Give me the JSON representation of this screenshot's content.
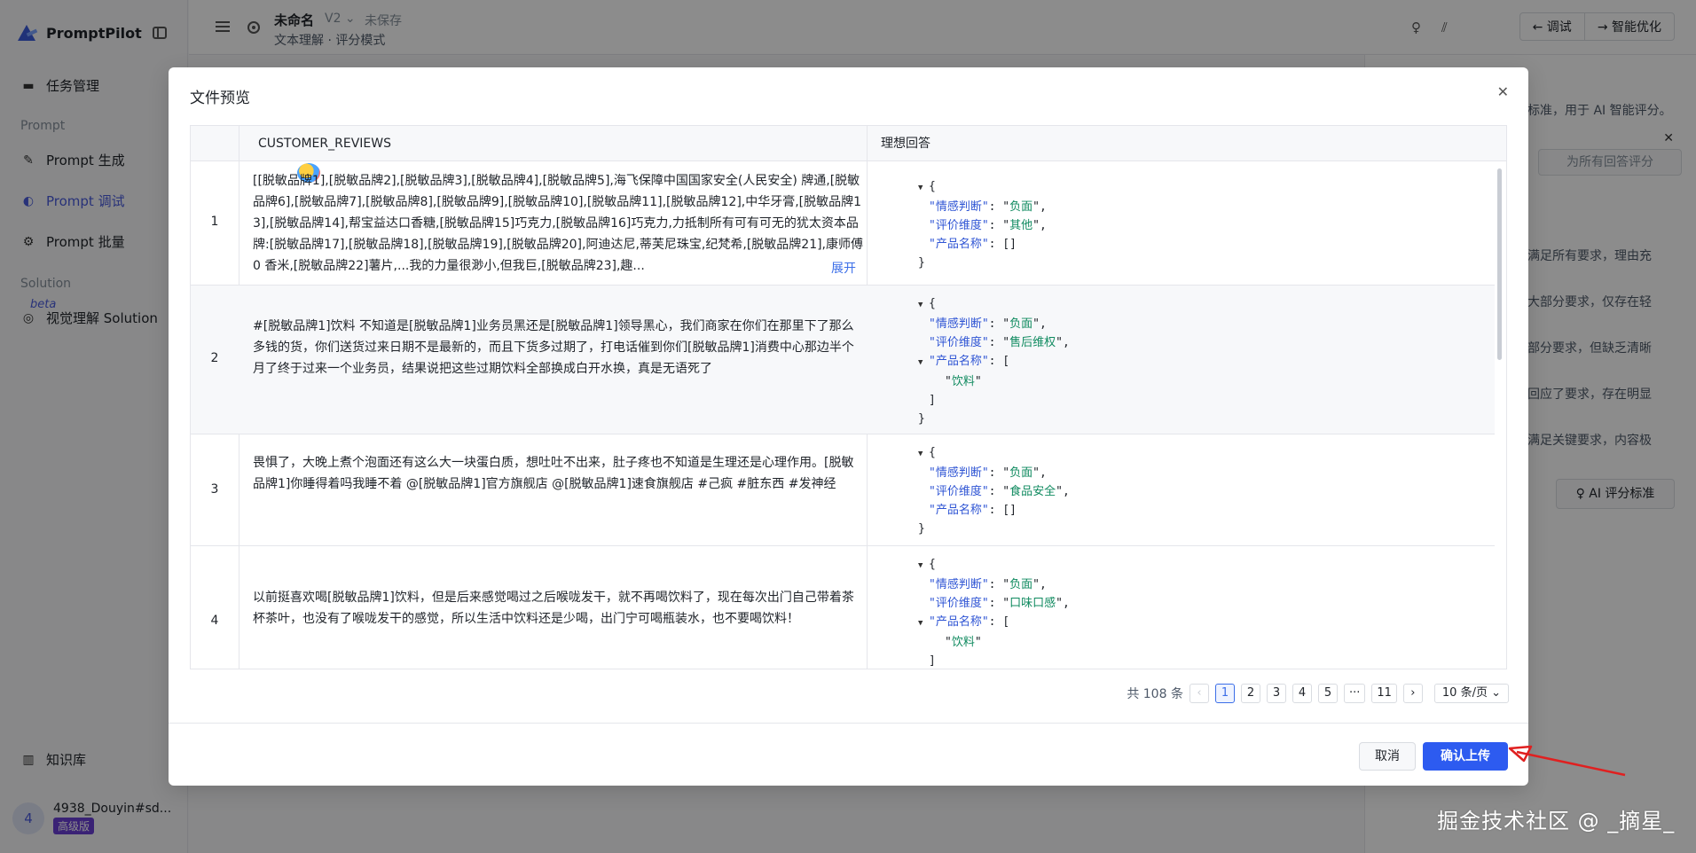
{
  "app": {
    "brand": "PromptPilot",
    "nav": {
      "task_mgmt": "任务管理",
      "group_prompt": "Prompt",
      "prompt_gen": "Prompt 生成",
      "prompt_debug": "Prompt 调试",
      "prompt_batch": "Prompt 批量",
      "group_solution": "Solution",
      "beta": "beta",
      "vision_solution": "视觉理解 Solution",
      "knowledge": "知识库"
    },
    "user": {
      "initial": "4",
      "name": "4938_Douyin#sd...",
      "tier": "高级版"
    },
    "topbar": {
      "title": "未命名",
      "version": "V2 ⌄",
      "save_status": "未保存",
      "subtitle": "文本理解 · 评分模式",
      "debug_label": "← 调试",
      "optimize_label": "→ 智能优化"
    },
    "right_panel": {
      "line1": "标准，用于 AI 智能评分。",
      "score_all_btn": "为所有回答评分",
      "criteria": [
        "满足所有要求，理由充",
        "大部分要求，仅存在轻",
        "部分要求，但缺乏清晰",
        "回应了要求，存在明显",
        "满足关键要求，内容极"
      ],
      "ai_criteria_btn": "♀ AI 评分标准"
    }
  },
  "modal": {
    "title": "文件预览",
    "columns": {
      "col1": "CUSTOMER_REVIEWS",
      "col2": "理想回答"
    },
    "rows": [
      {
        "num": "1",
        "text": "[[脱敏品牌1],[脱敏品牌2],[脱敏品牌3],[脱敏品牌4],[脱敏品牌5],海飞保障中国国家安全(人民安全) 牌通,[脱敏品牌6],[脱敏品牌7],[脱敏品牌8],[脱敏品牌9],[脱敏品牌10],[脱敏品牌11],[脱敏品牌12],中华牙膏,[脱敏品牌13],[脱敏品牌14],帮宝益达口香糖,[脱敏品牌15]巧克力,[脱敏品牌16]巧克力,力抵制所有可有可无的犹太资本品牌:[脱敏品牌17],[脱敏品牌18],[脱敏品牌19],[脱敏品牌20],阿迪达尼,蒂芙尼珠宝,纪梵希,[脱敏品牌21],康师傅 0 香米,[脱敏品牌22]薯片,...我的力量很渺小,但我巨,[脱敏品牌23],趣...",
        "expand": "展开",
        "answer": {
          "sentiment": "负面",
          "dimension": "其他",
          "products": []
        }
      },
      {
        "num": "2",
        "text": "#[脱敏品牌1]饮料 不知道是[脱敏品牌1]业务员黑还是[脱敏品牌1]领导黑心，我们商家在你们在那里下了那么多钱的货，你们送货过来日期不是最新的，而且下货多过期了，打电话催到你们[脱敏品牌1]消费中心那边半个月了终于过来一个业务员，结果说把这些过期饮料全部换成白开水换，真是无语死了",
        "answer": {
          "sentiment": "负面",
          "dimension": "售后维权",
          "products": [
            "饮料"
          ]
        }
      },
      {
        "num": "3",
        "text": "畏惧了，大晚上煮个泡面还有这么大一块蛋白质，想吐吐不出来，肚子疼也不知道是生理还是心理作用。[脱敏品牌1]你睡得着吗我睡不着 @[脱敏品牌1]官方旗舰店 @[脱敏品牌1]速食旗舰店 #己疯 #脏东西 #发神经",
        "answer": {
          "sentiment": "负面",
          "dimension": "食品安全",
          "products": []
        }
      },
      {
        "num": "4",
        "text": "以前挺喜欢喝[脱敏品牌1]饮料，但是后来感觉喝过之后喉咙发干，就不再喝饮料了，现在每次出门自己带着茶杯茶叶，也没有了喉咙发干的感觉，所以生活中饮料还是少喝，出门宁可喝瓶装水，也不要喝饮料！",
        "answer": {
          "sentiment": "负面",
          "dimension": "口味口感",
          "products": [
            "饮料"
          ]
        }
      }
    ],
    "json_keys": {
      "sentiment": "\"情感判断\"",
      "dimension": "\"评价维度\"",
      "products": "\"产品名称\""
    },
    "pagination": {
      "total": "共 108 条",
      "prev": "‹",
      "pages": [
        "1",
        "2",
        "3",
        "4",
        "5",
        "···",
        "11"
      ],
      "next": "›",
      "page_size": "10 条/页 ⌄"
    },
    "cancel": "取消",
    "confirm": "确认上传"
  },
  "watermark": "掘金技术社区 @ _摘星_",
  "colors": {
    "primary": "#2d5bf0",
    "annotation_arrow": "#e02020",
    "link": "#3b6ee8"
  }
}
